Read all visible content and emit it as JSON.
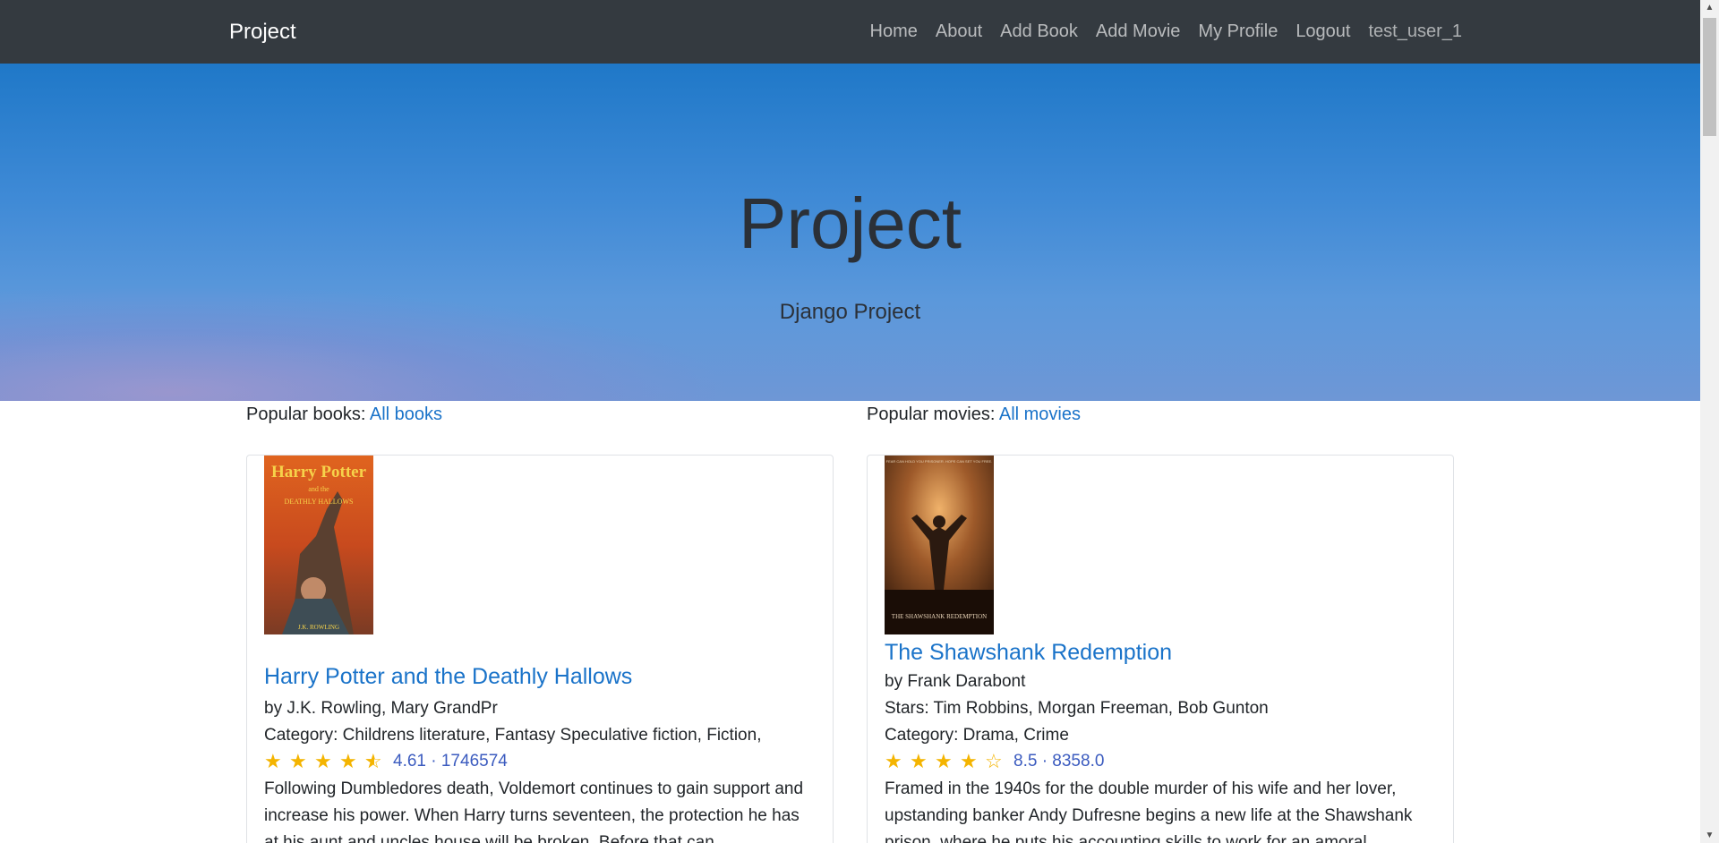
{
  "navbar": {
    "brand": "Project",
    "links": [
      "Home",
      "About",
      "Add Book",
      "Add Movie",
      "My Profile",
      "Logout"
    ],
    "username": "test_user_1"
  },
  "hero": {
    "title": "Project",
    "subtitle": "Django Project"
  },
  "books_section": {
    "label": "Popular books:",
    "link": "All books"
  },
  "movies_section": {
    "label": "Popular movies:",
    "link": "All movies"
  },
  "book_card": {
    "cover_title": "Harry Potter",
    "cover_subtitle": "and the",
    "cover_name": "DEATHLY HALLOWS",
    "cover_author": "J.K. ROWLING",
    "title": "Harry Potter and the Deathly Hallows",
    "by": "by J.K. Rowling, Mary GrandPr",
    "category": "Category: Childrens literature, Fantasy Speculative fiction, Fiction,",
    "stars": 4.5,
    "rating_text": "4.61 · 1746574",
    "description": "Following Dumbledores death, Voldemort continues to gain support and increase his power. When Harry turns seventeen, the protection he has at his aunt and uncles house will be broken. Before that can"
  },
  "movie_card": {
    "cover_tagline": "FEAR CAN HOLD YOU PRISONER. HOPE CAN SET YOU FREE.",
    "cover_title": "THE SHAWSHANK REDEMPTION",
    "title": "The Shawshank Redemption",
    "by": "by Frank Darabont",
    "stars_line": "Stars: Tim Robbins, Morgan Freeman, Bob Gunton",
    "category": "Category: Drama, Crime",
    "stars": 4,
    "rating_text": "8.5 · 8358.0",
    "description": "Framed in the 1940s for the double murder of his wife and her lover, upstanding banker Andy Dufresne begins a new life at the Shawshank prison, where he puts his accounting skills to work for an amoral"
  },
  "colors": {
    "navbar_bg": "#343a40",
    "link": "#1a73c9",
    "star": "#f4b400",
    "rating_text": "#3b5bbf"
  }
}
